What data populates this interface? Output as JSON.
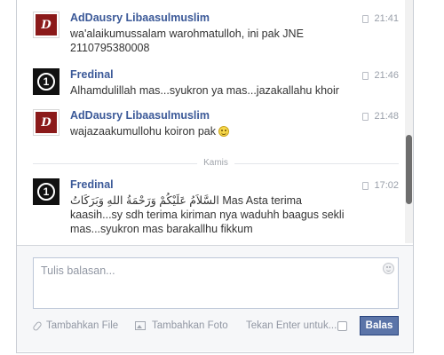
{
  "messages": [
    {
      "sender": "AdDausry Libaasulmuslim",
      "time": "21:41",
      "lines": [
        "wa'alaikumussalam warohmatulloh, ini pak JNE",
        "2110795380008"
      ],
      "avatar": "addausry-logo"
    },
    {
      "sender": "Fredinal",
      "time": "21:46",
      "lines": [
        "Alhamdulillah mas...syukron ya mas...jazakallahu khoir"
      ],
      "avatar": "fredinal-ring-logo"
    },
    {
      "sender": "AdDausry Libaasulmuslim",
      "time": "21:48",
      "lines": [
        "wajazaakumullohu koiron pak"
      ],
      "emoji": "smiley",
      "avatar": "addausry-logo"
    },
    {
      "sender": "Fredinal",
      "time": "17:02",
      "lines": [
        "السَّلاَمُ عَلَيْكُمْ وَرَحْمَةُ اللهِ وَبَرَكَاتُ Mas Asta terima",
        "kaasih...sy sdh terima kiriman nya waduhh baagus sekli",
        "mas...syukron mas barakallhu fikkum"
      ],
      "avatar": "fredinal-ring-logo"
    }
  ],
  "divider": {
    "label": "Kamis"
  },
  "composer": {
    "placeholder": "Tulis balasan...",
    "add_file": "Tambahkan File",
    "add_photo": "Tambahkan Foto",
    "enter_hint": "Tekan Enter untuk...",
    "send": "Balas"
  },
  "avatars": {
    "addausry_monogram": "D",
    "fredinal_mark": "1"
  },
  "colors": {
    "sender_name": "#3b5998",
    "send_button": "#5b74a8",
    "muted": "#9197a3"
  }
}
